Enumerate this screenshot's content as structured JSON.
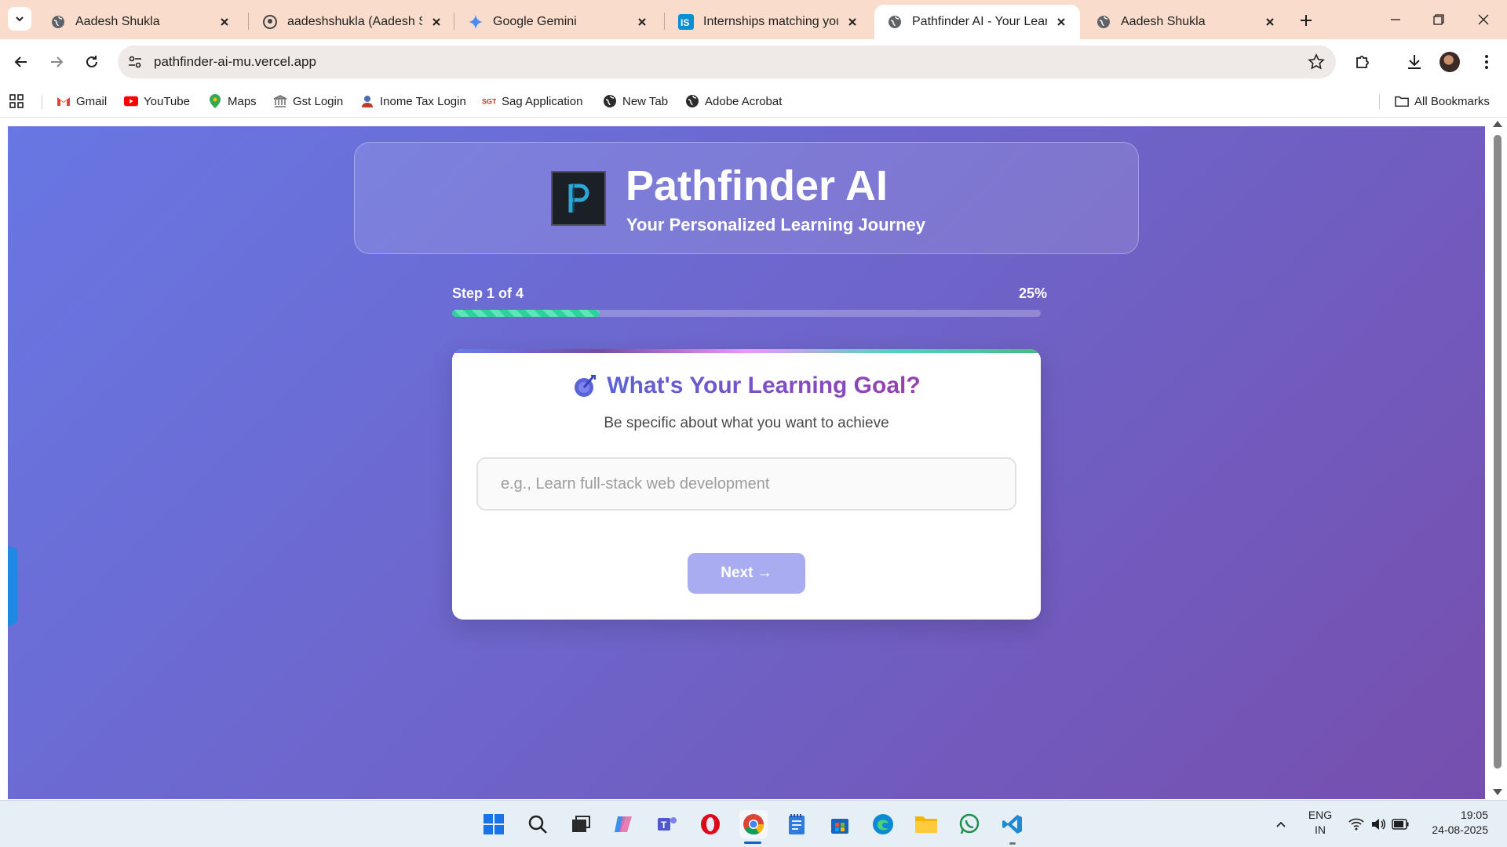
{
  "browser": {
    "tabs": [
      {
        "label": "Aadesh Shukla",
        "icon": "globe-icon",
        "active": false
      },
      {
        "label": "aadeshshukla (Aadesh Shu",
        "icon": "github-icon",
        "active": false
      },
      {
        "label": "Google Gemini",
        "icon": "gemini-icon",
        "active": false
      },
      {
        "label": "Internships matching your",
        "icon": "internshala-icon",
        "active": false
      },
      {
        "label": "Pathfinder AI - Your Learnin",
        "icon": "globe-icon",
        "active": true
      },
      {
        "label": "Aadesh Shukla",
        "icon": "globe-icon",
        "active": false
      }
    ],
    "url": "pathfinder-ai-mu.vercel.app",
    "bookmarks": [
      {
        "label": "Gmail",
        "icon": "gmail-icon"
      },
      {
        "label": "YouTube",
        "icon": "youtube-icon"
      },
      {
        "label": "Maps",
        "icon": "maps-icon"
      },
      {
        "label": "Gst Login",
        "icon": "gst-icon"
      },
      {
        "label": "Inome Tax Login",
        "icon": "income-tax-icon"
      },
      {
        "label": "Sag Application",
        "icon": "sag-icon"
      },
      {
        "label": "New Tab",
        "icon": "globe-icon"
      },
      {
        "label": "Adobe Acrobat",
        "icon": "globe-icon"
      }
    ],
    "all_bookmarks": "All Bookmarks"
  },
  "app": {
    "title": "Pathfinder AI",
    "subtitle": "Your Personalized Learning Journey",
    "progress": {
      "step_text": "Step 1 of 4",
      "percent_text": "25%",
      "fraction": 0.25
    },
    "card": {
      "title": "What's Your Learning Goal?",
      "subtitle": "Be specific about what you want to achieve",
      "input_value": "",
      "input_placeholder": "e.g., Learn full-stack web development",
      "next_label": "Next →"
    }
  },
  "taskbar": {
    "lang": "ENG",
    "region": "IN",
    "time": "19:05",
    "date": "24-08-2025"
  },
  "colors": {
    "accent": "#667eea",
    "accent2": "#764ba2",
    "progress": "#2ed19b",
    "button_disabled": "#a9acf0"
  }
}
